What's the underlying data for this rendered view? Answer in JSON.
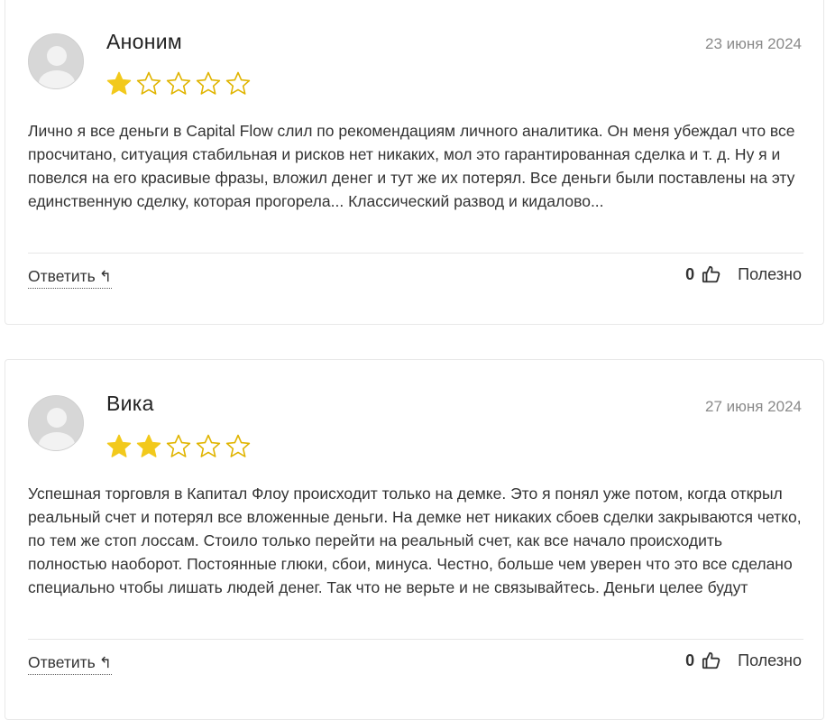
{
  "colors": {
    "star_filled": "#f2c91c",
    "star_outline": "#e0b400",
    "date": "#8a8a8a",
    "text": "#333333"
  },
  "reviews": [
    {
      "author": "Аноним",
      "date": "23 июня 2024",
      "rating": 1,
      "max_rating": 5,
      "text": "Лично я все деньги в Capital Flow слил по рекомендациям личного аналитика. Он меня убеждал что все просчитано, ситуация стабильная и рисков нет никаких, мол это гарантированная сделка и т. д. Ну я и повелся на его красивые фразы, вложил денег и тут же их потерял. Все деньги были поставлены на эту единственную сделку, которая прогорела... Классический развод и кидалово...",
      "reply_label": "Ответить",
      "useful_count": "0",
      "useful_label": "Полезно"
    },
    {
      "author": "Вика",
      "date": "27 июня 2024",
      "rating": 2,
      "max_rating": 5,
      "text": "Успешная торговля в Капитал Флоу происходит только на демке. Это я понял уже потом, когда открыл реальный счет и потерял все вложенные деньги. На демке нет никаких сбоев сделки закрываются четко, по тем же стоп лоссам. Стоило только перейти на реальный счет, как все начало происходить полностью наоборот. Постоянные глюки, сбои, минуса. Честно, больше чем уверен что это все сделано специально чтобы лишать людей денег. Так что не верьте и не связывайтесь. Деньги целее будут",
      "reply_label": "Ответить",
      "useful_count": "0",
      "useful_label": "Полезно"
    }
  ]
}
